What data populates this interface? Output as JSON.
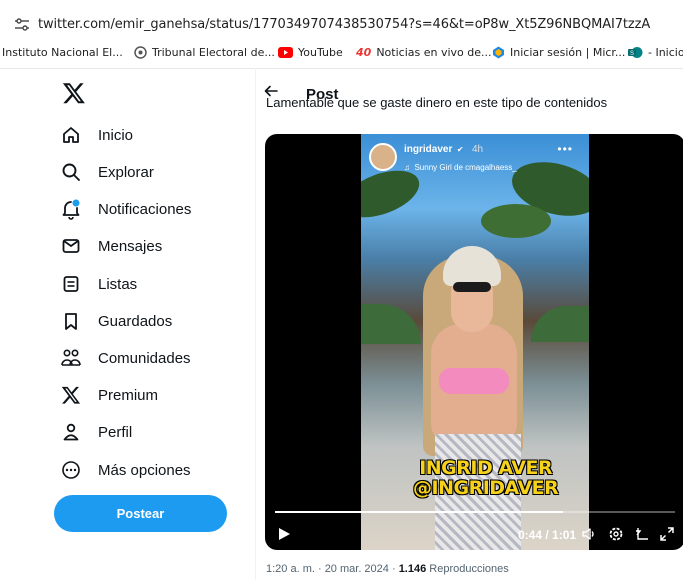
{
  "browser": {
    "url": "twitter.com/emir_ganehsa/status/1770349707438530754?s=46&t=oP8w_Xt5Z96NBQMAI7tzzA",
    "bookmarks": [
      {
        "label": "Instituto Nacional El...",
        "icon": "bookmark-generic"
      },
      {
        "label": "Tribunal Electoral de...",
        "icon": "tribunal-icon",
        "color": "#555555"
      },
      {
        "label": "YouTube",
        "icon": "youtube-icon",
        "color": "#ff0000"
      },
      {
        "label": "Noticias en vivo de...",
        "icon": "news-icon",
        "color": "#e53935"
      },
      {
        "label": "Iniciar sesión | Micr...",
        "icon": "microsoft-icon",
        "color": "#1e88e5"
      },
      {
        "label": "- Inicio",
        "icon": "sharepoint-icon",
        "color": "#038387"
      }
    ]
  },
  "sidebar": {
    "items": [
      {
        "label": "Inicio",
        "icon": "home-icon"
      },
      {
        "label": "Explorar",
        "icon": "search-icon"
      },
      {
        "label": "Notificaciones",
        "icon": "bell-icon"
      },
      {
        "label": "Mensajes",
        "icon": "mail-icon"
      },
      {
        "label": "Listas",
        "icon": "list-icon"
      },
      {
        "label": "Guardados",
        "icon": "bookmark-icon"
      },
      {
        "label": "Comunidades",
        "icon": "communities-icon"
      },
      {
        "label": "Premium",
        "icon": "x-logo-icon"
      },
      {
        "label": "Perfil",
        "icon": "profile-icon"
      },
      {
        "label": "Más opciones",
        "icon": "more-icon"
      }
    ],
    "post_button": "Postear",
    "accent": "#1d9bf0"
  },
  "post": {
    "header_title": "Post",
    "text": "Lamentable que se gaste dinero en este tipo de contenidos",
    "video": {
      "story_user": "ingridaver",
      "story_time": "4h",
      "story_song": "Sunny Girl de cmagalhaess_",
      "caption_line1": "INGRID AVER",
      "caption_line2": "@INGRIDAVER",
      "time_display": "0:44 / 1:01",
      "progress": 0.72
    },
    "meta": {
      "time_date": "1:20 a. m. · 20 mar. 2024 · ",
      "views_count": "1.146",
      "views_label": " Reproducciones"
    }
  }
}
